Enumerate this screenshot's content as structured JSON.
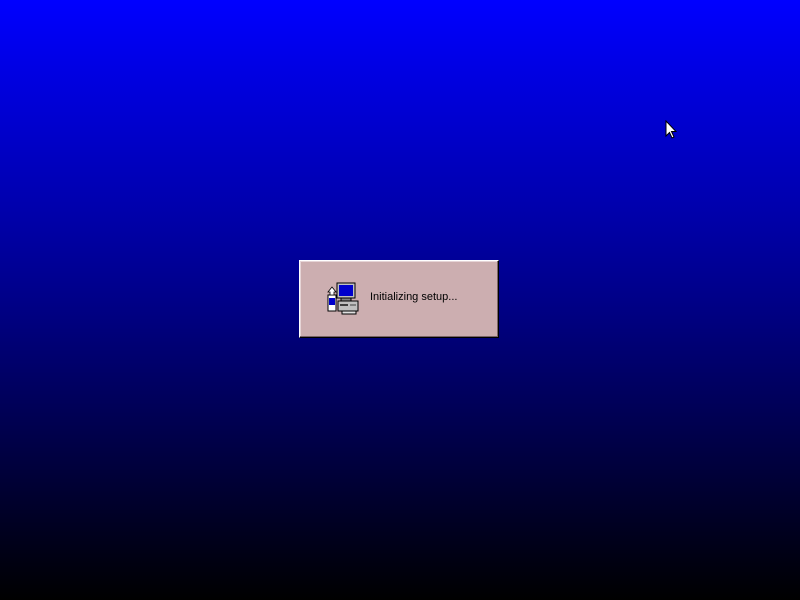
{
  "desktop": {
    "background_top": "#0000ff",
    "background_bottom": "#000000"
  },
  "dialog": {
    "message": "Initializing setup...",
    "icon": "setup-computer-icon",
    "background": "#ccaeb0"
  },
  "cursor": {
    "icon": "arrow-cursor-icon"
  }
}
